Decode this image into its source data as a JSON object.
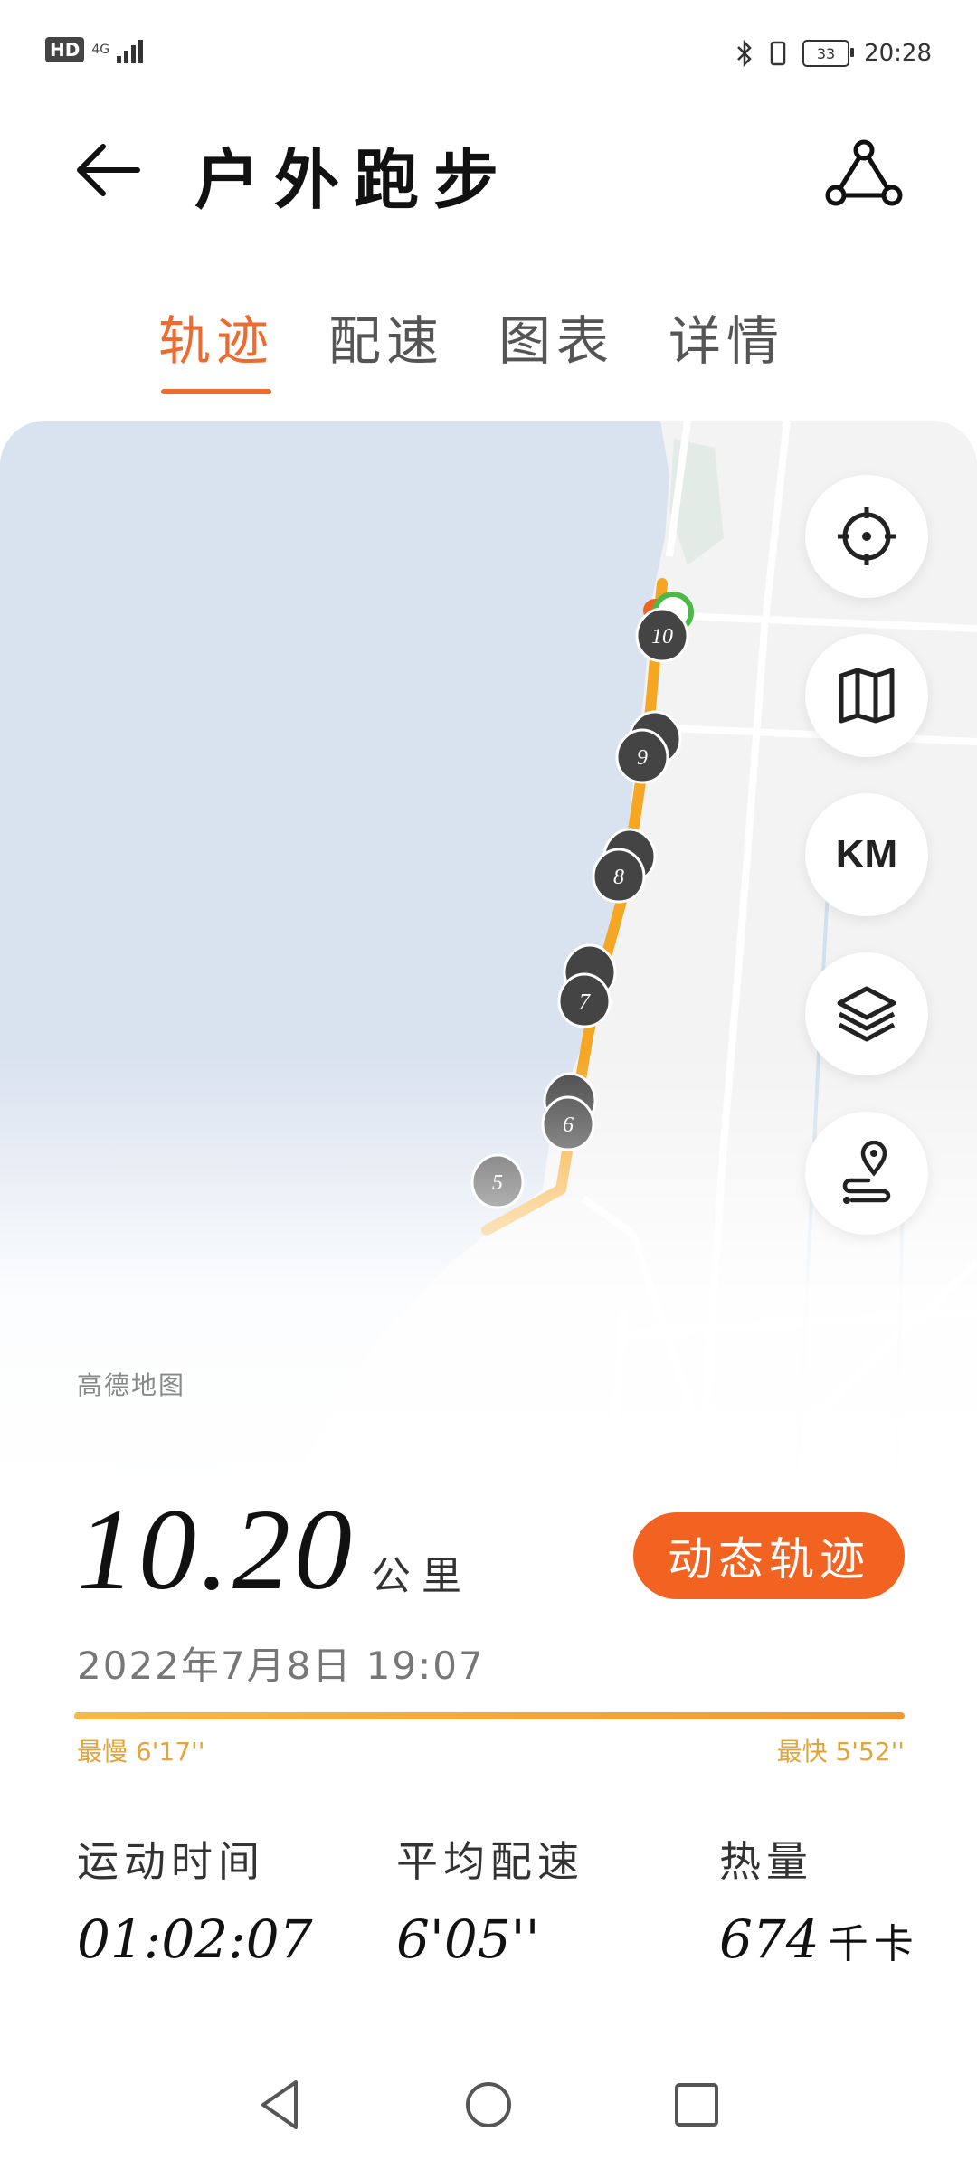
{
  "status_bar": {
    "hd": "HD",
    "network": "4G",
    "battery": "33",
    "time": "20:28"
  },
  "header": {
    "title": "户外跑步"
  },
  "tabs": [
    "轨迹",
    "配速",
    "图表",
    "详情"
  ],
  "map": {
    "credit": "高德地图",
    "km_label": "KM",
    "markers": [
      "10",
      "9",
      "8",
      "7",
      "6",
      "5"
    ]
  },
  "summary": {
    "distance": "10.20",
    "distance_unit": "公里",
    "dynamic_button": "动态轨迹",
    "date": "2022年7月8日   19:07",
    "slowest": "最慢 6'17''",
    "fastest": "最快 5'52''"
  },
  "stats": [
    {
      "label": "运动时间",
      "value": "01:02:07",
      "unit": ""
    },
    {
      "label": "平均配速",
      "value": "6'05''",
      "unit": ""
    },
    {
      "label": "热量",
      "value": "674",
      "unit": "千卡"
    }
  ],
  "colors": {
    "accent": "#ee6a2e",
    "button": "#f26322",
    "track": "#f5a623",
    "water": "#d9e2ef"
  }
}
